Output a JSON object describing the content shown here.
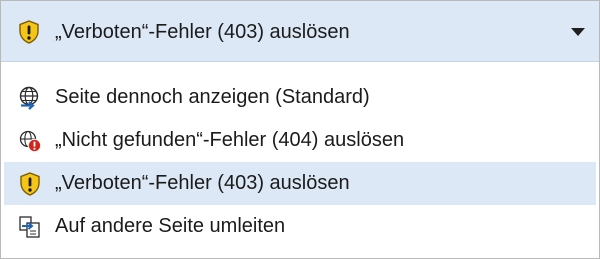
{
  "combo": {
    "selected_label": "„Verboten“-Fehler (403) auslösen",
    "selected_icon": "shield-warning-icon",
    "arrow_icon": "chevron-down-icon"
  },
  "options": [
    {
      "label": "Seite dennoch anzeigen (Standard)",
      "icon": "globe-arrow-icon",
      "selected": false
    },
    {
      "label": "„Nicht gefunden“-Fehler (404) auslösen",
      "icon": "page-error-icon",
      "selected": false
    },
    {
      "label": "„Verboten“-Fehler (403) auslösen",
      "icon": "shield-warning-icon",
      "selected": true
    },
    {
      "label": "Auf andere Seite umleiten",
      "icon": "redirect-icon",
      "selected": false
    }
  ],
  "colors": {
    "selection_bg": "#dce8f6",
    "shield_yellow": "#f5c518",
    "error_red": "#d1261d",
    "globe_blue": "#1e63b8"
  }
}
